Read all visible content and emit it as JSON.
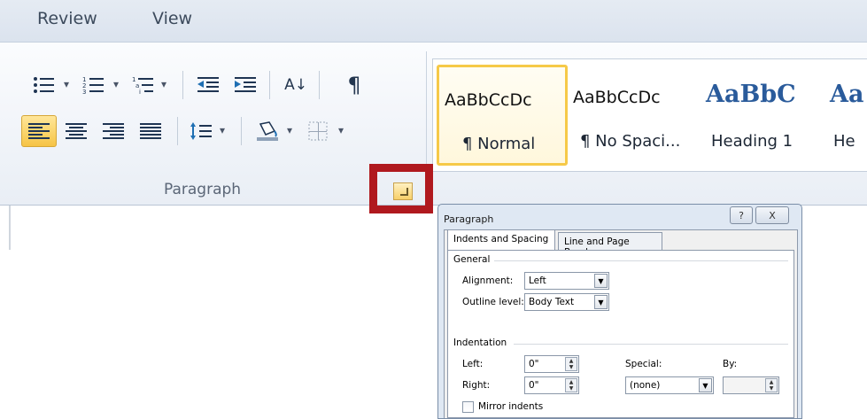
{
  "menubar": {
    "items": [
      "Review",
      "View"
    ]
  },
  "paragraph_group": {
    "label": "Paragraph",
    "row1_icons": [
      "bullets-icon",
      "numbering-icon",
      "multilevel-list-icon",
      "decrease-indent-icon",
      "increase-indent-icon",
      "sort-icon",
      "show-formatting-marks-icon"
    ],
    "row2_icons": [
      "align-left-icon",
      "center-icon",
      "align-right-icon",
      "justify-icon",
      "line-spacing-icon",
      "shading-icon",
      "borders-icon"
    ],
    "sort_glyph": "A↓",
    "pilcrow": "¶"
  },
  "styles_gallery": {
    "tiles": [
      {
        "sample": "AaBbCcDc",
        "name": "¶ Normal"
      },
      {
        "sample": "AaBbCcDc",
        "name": "¶ No Spaci..."
      },
      {
        "sample": "AaBbC",
        "name": "Heading 1"
      },
      {
        "sample": "Aa",
        "name": "He"
      }
    ]
  },
  "dialog": {
    "title": "Paragraph",
    "help": "?",
    "close": "X",
    "tabs": [
      "Indents and Spacing",
      "Line and Page Breaks"
    ],
    "general": {
      "heading": "General",
      "alignment_label": "Alignment:",
      "alignment_value": "Left",
      "outline_label": "Outline level:",
      "outline_value": "Body Text"
    },
    "indentation": {
      "heading": "Indentation",
      "left_label": "Left:",
      "left_value": "0\"",
      "right_label": "Right:",
      "right_value": "0\"",
      "special_label": "Special:",
      "special_value": "(none)",
      "by_label": "By:",
      "by_value": "",
      "mirror_label": "Mirror indents"
    }
  },
  "colors": {
    "highlight": "#b0191e",
    "active_button": "#f6c445",
    "heading_blue": "#2a5b9b"
  }
}
